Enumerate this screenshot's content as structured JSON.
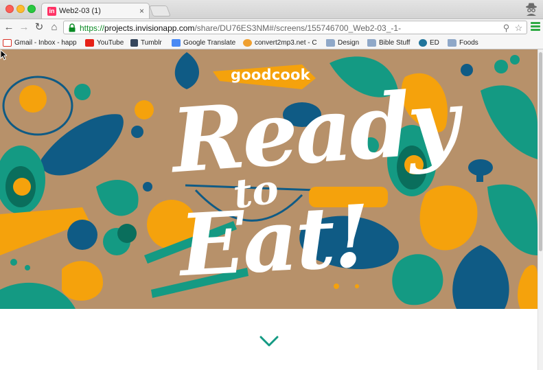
{
  "window": {
    "tab_title": "Web2-03 (1)",
    "tab_favicon_letter": "in",
    "tab_close": "×"
  },
  "toolbar": {
    "url_scheme": "https://",
    "url_host": "projects.invisionapp.com",
    "url_path": "/share/DU76ES3NM#/screens/155746700_Web2-03_-1-"
  },
  "bookmarks": [
    {
      "label": "Gmail - Inbox - happ",
      "icon": "gmail-icon",
      "color": "#d93025"
    },
    {
      "label": "YouTube",
      "icon": "youtube-icon",
      "color": "#e62117"
    },
    {
      "label": "Tumblr",
      "icon": "tumblr-icon",
      "color": "#35465c"
    },
    {
      "label": "Google Translate",
      "icon": "translate-icon",
      "color": "#4a8af4"
    },
    {
      "label": "convert2mp3.net - C",
      "icon": "convert-icon",
      "color": "#f0a030"
    },
    {
      "label": "Design",
      "icon": "folder-icon",
      "color": "#8fa8c8"
    },
    {
      "label": "Bible Stuff",
      "icon": "folder-icon",
      "color": "#8fa8c8"
    },
    {
      "label": "ED",
      "icon": "wordpress-icon",
      "color": "#21759b"
    },
    {
      "label": "Foods",
      "icon": "folder-icon",
      "color": "#8fa8c8"
    }
  ],
  "hero": {
    "brand": "goodcook",
    "line1": "Ready",
    "line2": "to",
    "line3": "Eat!"
  },
  "colors": {
    "background": "#b7916a",
    "teal": "#149a83",
    "navy": "#0f5b85",
    "orange": "#f5a20c",
    "white": "#ffffff"
  }
}
